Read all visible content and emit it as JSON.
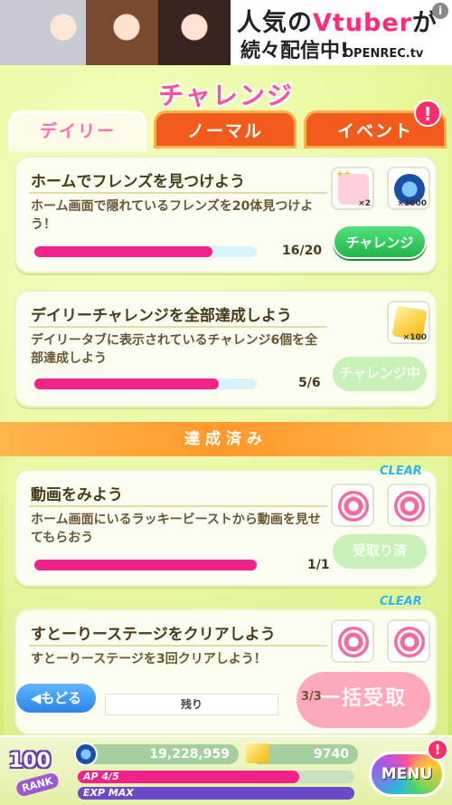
{
  "ad": {
    "line1_prefix": "人気の",
    "line1_highlight": "Vtuber",
    "line1_suffix": "が",
    "line2": "続々配信中!",
    "brand": "OPENREC.tv",
    "info_icon": "i"
  },
  "header": {
    "title": "チャレンジ"
  },
  "tabs": [
    {
      "label": "デイリー",
      "active": true
    },
    {
      "label": "ノーマル",
      "active": false
    },
    {
      "label": "イベント",
      "active": false,
      "badge": "!"
    }
  ],
  "challenges": [
    {
      "title": "ホームでフレンズを見つけよう",
      "desc": "ホーム画面で隠れているフレンズを20体見つけよう！",
      "count": "16/20",
      "progress": 0.8,
      "rewards": [
        {
          "icon": "shoe-icon",
          "qty": "×2"
        },
        {
          "icon": "coin-icon",
          "qty": "×3000"
        }
      ],
      "button": "チャレンジ"
    },
    {
      "title": "デイリーチャレンジを全部達成しよう",
      "desc": "デイリータブに表示されているチャレンジ6個を全部達成しよう",
      "count": "5/6",
      "progress": 0.83,
      "rewards": [
        {
          "icon": "gem-icon",
          "qty": "×100"
        }
      ],
      "button": "チャレンジ中"
    }
  ],
  "section": {
    "completed_label": "達成済み"
  },
  "completed": [
    {
      "title": "動画をみよう",
      "desc": "ホーム画面にいるラッキービーストから動画を見せてもらおう",
      "count": "1/1",
      "progress": 1.0,
      "clear": "CLEAR",
      "button": "受取り済"
    },
    {
      "title": "すとーりーステージをクリアしよう",
      "desc": "すとーりーステージを3回クリアしよう！",
      "count": "3/3",
      "clear": "CLEAR"
    }
  ],
  "footer": {
    "back_label": "もどる",
    "remain_label": "残り",
    "bulk_label": "一括受取"
  },
  "status": {
    "rank": "100",
    "rank_label": "RANK",
    "money": "19,228,959",
    "gems": "9740",
    "ap_label": "AP 4/5",
    "ap_fraction": 0.8,
    "exp_label": "EXP MAX",
    "exp_fraction": 1.0,
    "menu_label": "MENU",
    "menu_badge": "!"
  },
  "colors": {
    "accent_pink": "#f0238a",
    "tab_orange": "#f25b1c",
    "button_green": "#22b64a",
    "clear_blue": "#2ab6e0"
  }
}
